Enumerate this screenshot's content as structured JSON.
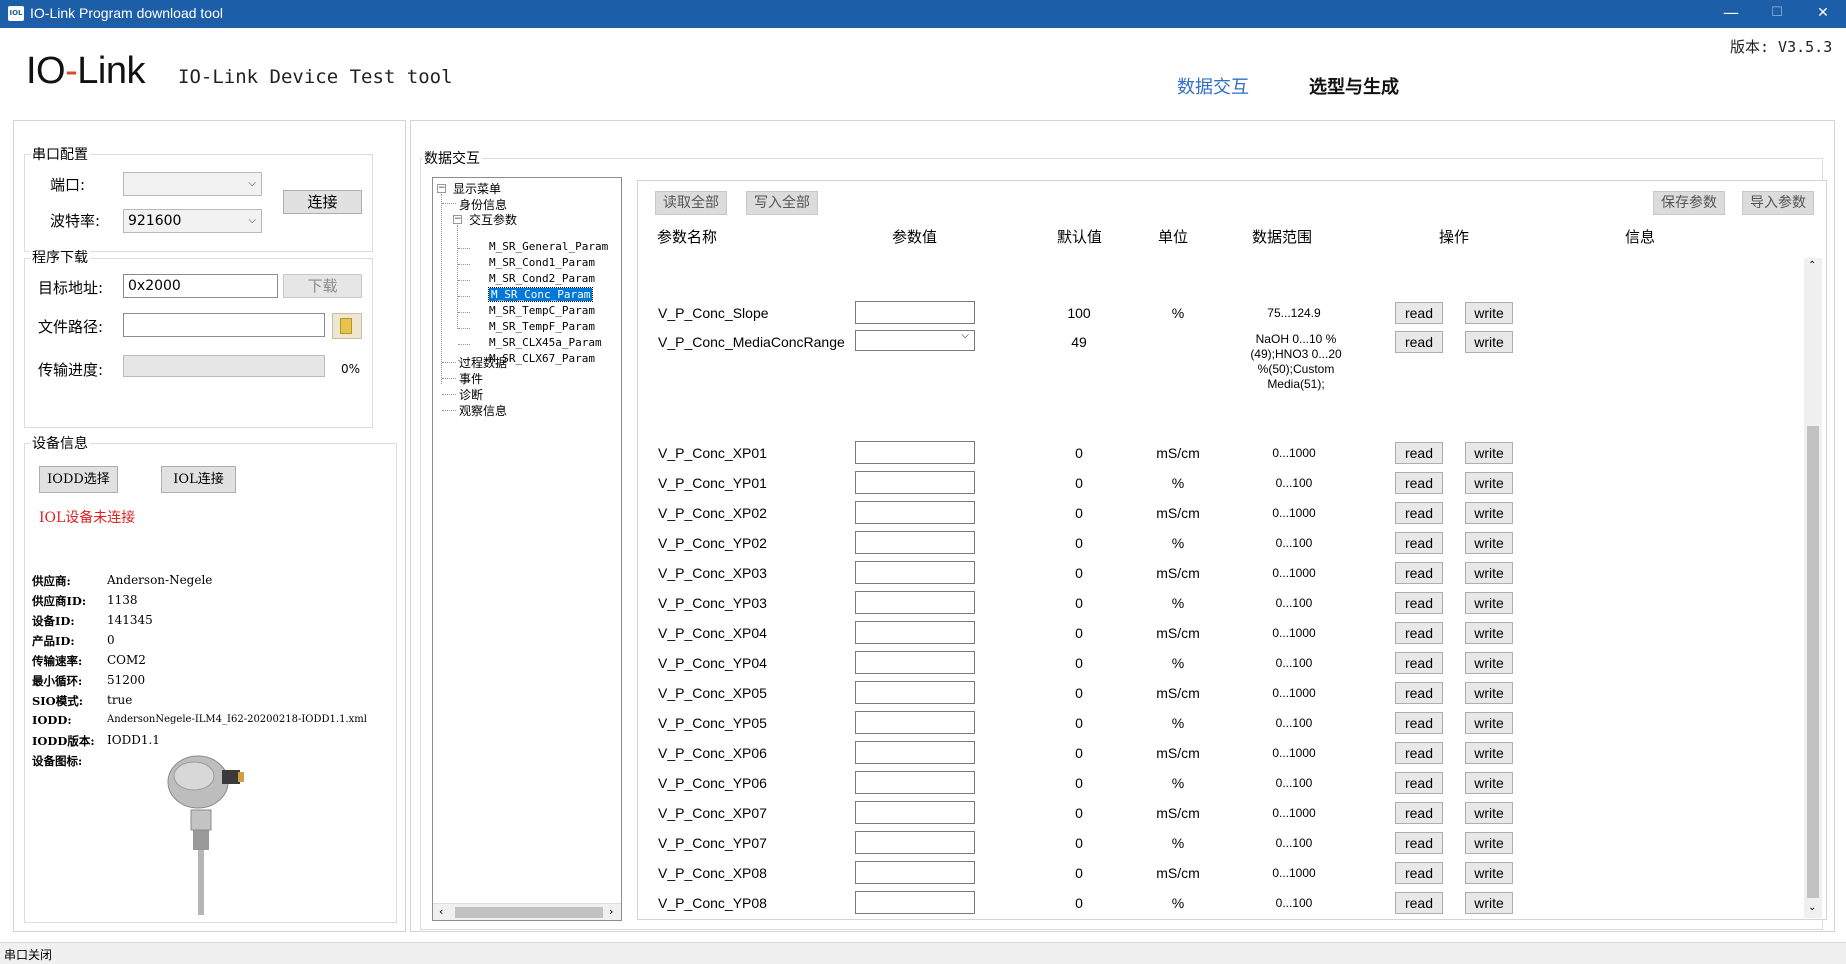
{
  "window": {
    "title": "IO-Link Program download tool",
    "icon_text": "IOL",
    "minimize": "—",
    "maximize": "☐",
    "close": "✕"
  },
  "header": {
    "logo_io": "IO",
    "logo_dash": "-",
    "logo_link": "Link",
    "subtitle": "IO-Link Device Test tool",
    "version": "版本: V3.5.3",
    "tabs": [
      {
        "label": "数据交互",
        "active": true
      },
      {
        "label": "选型与生成",
        "active": false
      }
    ],
    "active_tab_color": "#2f6fc5"
  },
  "serial": {
    "group_label": "串口配置",
    "port_label": "端口:",
    "port_value": "",
    "baud_label": "波特率:",
    "baud_value": "921600",
    "connect_button": "连接"
  },
  "download": {
    "group_label": "程序下载",
    "address_label": "目标地址:",
    "address_value": "0x2000",
    "download_button": "下载",
    "file_label": "文件路径:",
    "file_value": "",
    "progress_label": "传输进度:",
    "progress_value": "0%",
    "progress_fraction": 0
  },
  "device": {
    "group_label": "设备信息",
    "iodd_button": "IODD选择",
    "iol_button": "IOL连接",
    "status_text": "IOL设备未连接",
    "status_color": "#e02020",
    "info": [
      {
        "key": "供应商:",
        "value": "Anderson-Negele"
      },
      {
        "key": "供应商ID:",
        "value": "1138"
      },
      {
        "key": "设备ID:",
        "value": "141345"
      },
      {
        "key": "产品ID:",
        "value": "0"
      },
      {
        "key": "传输速率:",
        "value": "COM2"
      },
      {
        "key": "最小循环:",
        "value": "51200"
      },
      {
        "key": "SIO模式:",
        "value": "true"
      },
      {
        "key": "IODD:",
        "value": "AndersonNegele-ILM4_I62-20200218-IODD1.1.xml"
      },
      {
        "key": "IODD版本:",
        "value": "IODD1.1"
      },
      {
        "key": "设备图标:",
        "value": ""
      }
    ]
  },
  "interaction": {
    "group_label": "数据交互",
    "read_all": "读取全部",
    "write_all": "写入全部",
    "save_params": "保存参数",
    "import_params": "导入参数",
    "tree": {
      "root": "显示菜单",
      "identity": "身份信息",
      "params": "交互参数",
      "param_items": [
        "M_SR_General_Param",
        "M_SR_Cond1_Param",
        "M_SR_Cond2_Param",
        "M_SR_Conc_Param",
        "M_SR_TempC_Param",
        "M_SR_TempF_Param",
        "M_SR_CLX45a_Param",
        "M_SR_CLX67_Param"
      ],
      "selected": "M_SR_Conc_Param",
      "process": "过程数据",
      "events": "事件",
      "diagnosis": "诊断",
      "observe": "观察信息"
    },
    "columns": [
      "参数名称",
      "参数值",
      "默认值",
      "单位",
      "数据范围",
      "操作",
      "信息"
    ],
    "read_label": "read",
    "write_label": "write",
    "rows": [
      {
        "name": "V_P_Conc_Slope",
        "default": "100",
        "unit": "%",
        "range": "75...124.9",
        "input": "text"
      },
      {
        "name": "V_P_Conc_MediaConcRange",
        "default": "49",
        "unit": "",
        "range": "NaOH 0...10 %(49);HNO3 0...20 %(50);Custom Media(51);",
        "input": "select"
      },
      {
        "name": "V_P_Conc_XP01",
        "default": "0",
        "unit": "mS/cm",
        "range": "0...1000",
        "input": "text"
      },
      {
        "name": "V_P_Conc_YP01",
        "default": "0",
        "unit": "%",
        "range": "0...100",
        "input": "text"
      },
      {
        "name": "V_P_Conc_XP02",
        "default": "0",
        "unit": "mS/cm",
        "range": "0...1000",
        "input": "text"
      },
      {
        "name": "V_P_Conc_YP02",
        "default": "0",
        "unit": "%",
        "range": "0...100",
        "input": "text"
      },
      {
        "name": "V_P_Conc_XP03",
        "default": "0",
        "unit": "mS/cm",
        "range": "0...1000",
        "input": "text"
      },
      {
        "name": "V_P_Conc_YP03",
        "default": "0",
        "unit": "%",
        "range": "0...100",
        "input": "text"
      },
      {
        "name": "V_P_Conc_XP04",
        "default": "0",
        "unit": "mS/cm",
        "range": "0...1000",
        "input": "text"
      },
      {
        "name": "V_P_Conc_YP04",
        "default": "0",
        "unit": "%",
        "range": "0...100",
        "input": "text"
      },
      {
        "name": "V_P_Conc_XP05",
        "default": "0",
        "unit": "mS/cm",
        "range": "0...1000",
        "input": "text"
      },
      {
        "name": "V_P_Conc_YP05",
        "default": "0",
        "unit": "%",
        "range": "0...100",
        "input": "text"
      },
      {
        "name": "V_P_Conc_XP06",
        "default": "0",
        "unit": "mS/cm",
        "range": "0...1000",
        "input": "text"
      },
      {
        "name": "V_P_Conc_YP06",
        "default": "0",
        "unit": "%",
        "range": "0...100",
        "input": "text"
      },
      {
        "name": "V_P_Conc_XP07",
        "default": "0",
        "unit": "mS/cm",
        "range": "0...1000",
        "input": "text"
      },
      {
        "name": "V_P_Conc_YP07",
        "default": "0",
        "unit": "%",
        "range": "0...100",
        "input": "text"
      },
      {
        "name": "V_P_Conc_XP08",
        "default": "0",
        "unit": "mS/cm",
        "range": "0...1000",
        "input": "text"
      },
      {
        "name": "V_P_Conc_YP08",
        "default": "0",
        "unit": "%",
        "range": "0...100",
        "input": "text"
      }
    ]
  },
  "statusbar": {
    "text": "串口关闭"
  }
}
